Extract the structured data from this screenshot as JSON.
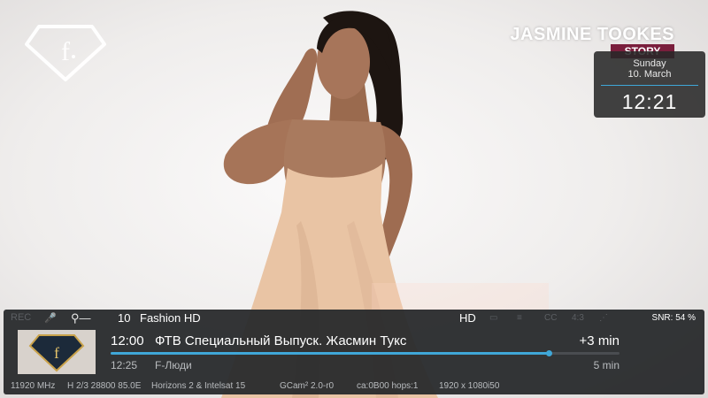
{
  "overlay": {
    "show_name": "JASMINE TOOKES",
    "show_tag": "STORY",
    "clock": {
      "day": "Sunday",
      "date": "10. March",
      "time": "12:21"
    },
    "logo_icon": "fashion-tv-diamond-logo"
  },
  "infobar": {
    "status_left": {
      "rec": "REC",
      "mic_icon": "mic-icon",
      "key_icon": "key-icon"
    },
    "channel": {
      "number": "10",
      "name": "Fashion HD"
    },
    "flags": {
      "hd": "HD",
      "indicators": [
        "▭",
        "≡",
        "CC",
        "4:3",
        "⋰"
      ]
    },
    "snr": "SNR: 54 %",
    "now": {
      "time": "12:00",
      "title": "ФТВ Специальный Выпуск. Жасмин Тукс",
      "remaining": "+3 min",
      "progress": 0.86
    },
    "next": {
      "time": "12:25",
      "title": "F-Люди",
      "duration": "5 min"
    },
    "tech": {
      "frequency": "11920 MHz",
      "transponder": "H 2/3 28800 85.0E",
      "satellite": "Horizons 2 & Intelsat 15",
      "cam": "GCam² 2.0-r0",
      "ca": "ca:0B00 hops:1",
      "resolution": "1920 x 1080i50"
    }
  },
  "colors": {
    "accent": "#3fa7d8",
    "bar": "#26282b",
    "tag": "#7a1e3c"
  }
}
